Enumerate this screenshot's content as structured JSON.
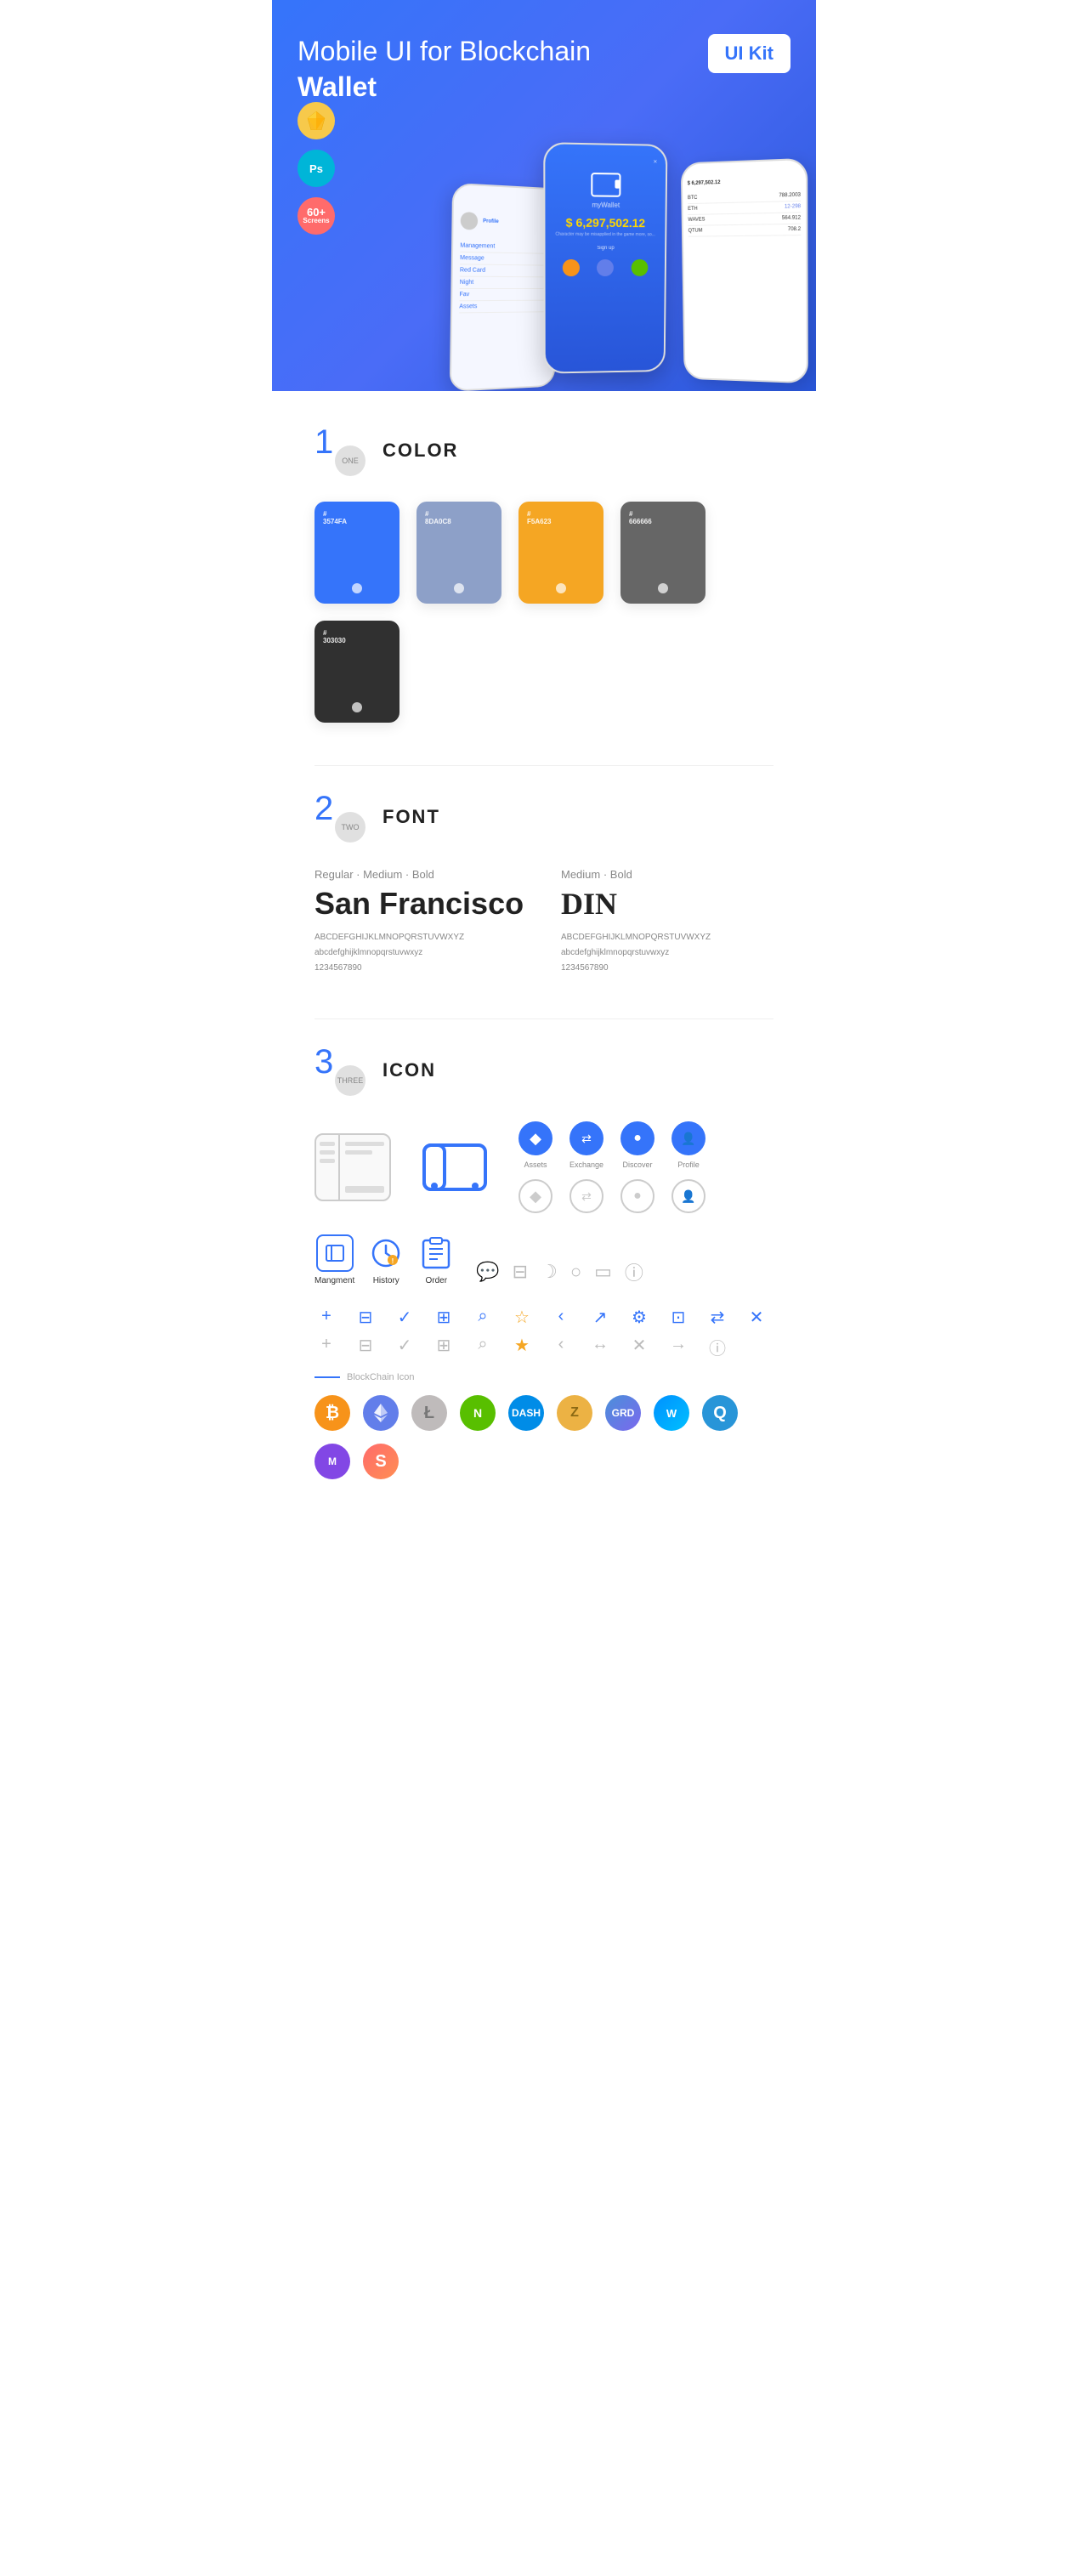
{
  "hero": {
    "title_normal": "Mobile UI for Blockchain ",
    "title_bold": "Wallet",
    "badge": "UI Kit",
    "tools": [
      {
        "label": "Sk",
        "type": "sketch"
      },
      {
        "label": "Ps",
        "type": "photoshop"
      },
      {
        "label": "60+\nScreens",
        "type": "screens"
      }
    ]
  },
  "sections": {
    "color": {
      "number": "1",
      "number_label": "ONE",
      "title": "COLOR",
      "swatches": [
        {
          "hex": "#3574FA",
          "code": "#\n3574FA"
        },
        {
          "hex": "#8DA0C8",
          "code": "#\n8DA0C8"
        },
        {
          "hex": "#F5A623",
          "code": "#\nF5A623"
        },
        {
          "hex": "#666666",
          "code": "#\n666666"
        },
        {
          "hex": "#303030",
          "code": "#\n303030"
        }
      ]
    },
    "font": {
      "number": "2",
      "number_label": "TWO",
      "title": "FONT",
      "fonts": [
        {
          "weight_label": "Regular · Medium · Bold",
          "name": "San Francisco",
          "uppercase": "ABCDEFGHIJKLMNOPQRSTUVWXYZ",
          "lowercase": "abcdefghijklmnopqrstuvwxyz",
          "numbers": "1234567890"
        },
        {
          "weight_label": "Medium · Bold",
          "name": "DIN",
          "uppercase": "ABCDEFGHIJKLMNOPQRSTUVWXYZ",
          "lowercase": "abcdefghijklmnopqrstuvwxyz",
          "numbers": "1234567890"
        }
      ]
    },
    "icon": {
      "number": "3",
      "number_label": "THREE",
      "title": "ICON",
      "nav_icons": [
        {
          "label": "Assets",
          "filled": true
        },
        {
          "label": "Exchange",
          "filled": true
        },
        {
          "label": "Discover",
          "filled": true
        },
        {
          "label": "Profile",
          "filled": true
        }
      ],
      "bottom_nav": [
        {
          "label": "Mangment"
        },
        {
          "label": "History"
        },
        {
          "label": "Order"
        }
      ],
      "blockchain_label": "BlockChain Icon",
      "crypto_icons": [
        "BTC",
        "ETH",
        "LTC",
        "NEO",
        "DASH",
        "ZEC",
        "GRID",
        "WAVES",
        "QTUM",
        "MATIC",
        "OTHER"
      ]
    }
  }
}
